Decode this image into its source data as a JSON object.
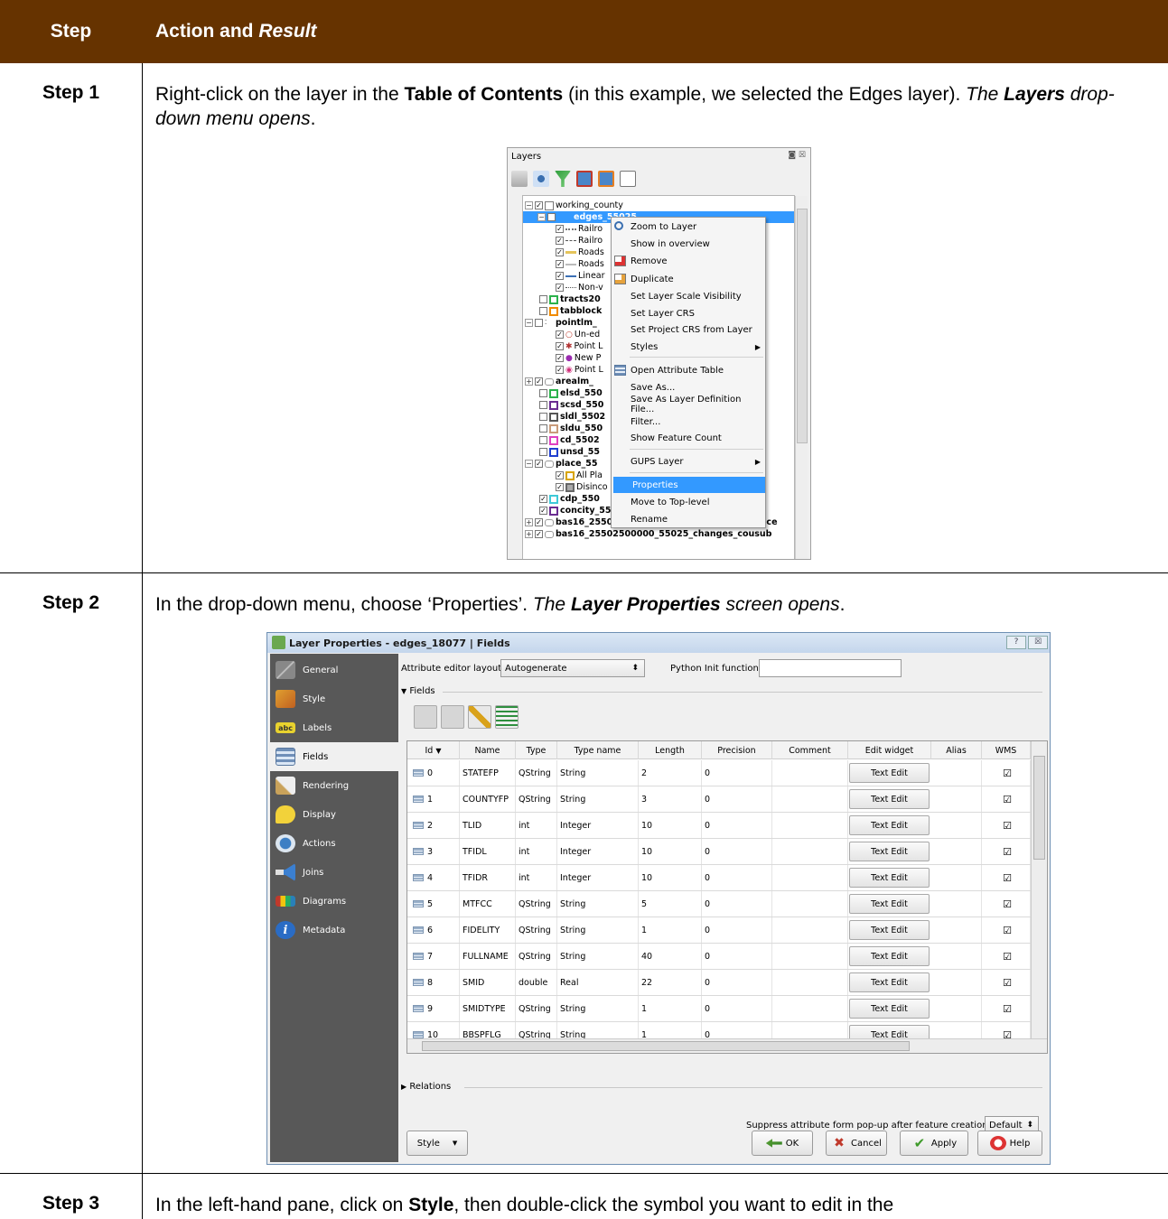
{
  "table": {
    "header_step": "Step",
    "header_action": "Action and",
    "header_result": "Result"
  },
  "step1": {
    "label": "Step 1",
    "text_a": "Right-click on the layer in the ",
    "text_b": "Table of Contents",
    "text_c": " (in this example, we selected the Edges layer). ",
    "text_d": "The ",
    "text_e": "Layers",
    "text_f": " drop-down menu opens",
    "text_g": "."
  },
  "step2": {
    "label": "Step 2",
    "text_a": "In the drop-down menu, choose ‘Properties’. ",
    "text_b": "The ",
    "text_c": "Layer Properties",
    "text_d": " screen opens",
    "text_e": "."
  },
  "step3": {
    "label": "Step 3",
    "text_a": "In the left-hand pane, click on ",
    "text_b": "Style",
    "text_c": ", then double-click the symbol you want to edit in the"
  },
  "layers_panel": {
    "title": "Layers",
    "controls": "◙ ☒",
    "rows": [
      {
        "label": "working_county"
      },
      {
        "label": "edges_55025"
      },
      {
        "label": "Railro"
      },
      {
        "label": "Railro"
      },
      {
        "label": "Roads"
      },
      {
        "label": "Roads"
      },
      {
        "label": "Linear"
      },
      {
        "label": "Non-v"
      },
      {
        "label": "tracts20"
      },
      {
        "label": "tabblock"
      },
      {
        "label": "pointlm_"
      },
      {
        "label": "Un-ed"
      },
      {
        "label": "Point L"
      },
      {
        "label": "New P"
      },
      {
        "label": "Point L"
      },
      {
        "label": "arealm_"
      },
      {
        "label": "elsd_550"
      },
      {
        "label": "scsd_550"
      },
      {
        "label": "sldl_5502"
      },
      {
        "label": "sldu_550"
      },
      {
        "label": "cd_5502"
      },
      {
        "label": "unsd_55"
      },
      {
        "label": "place_55"
      },
      {
        "label": "All Pla"
      },
      {
        "label": "Disinco"
      },
      {
        "label": "cdp_550"
      },
      {
        "label": "concity_55025"
      },
      {
        "label": "bas16_25502500000_55025_changes_incplace"
      },
      {
        "label": "bas16_25502500000_55025_changes_cousub"
      }
    ]
  },
  "context_menu": {
    "items": [
      "Zoom to Layer",
      "Show in overview",
      "Remove",
      "Duplicate",
      "Set Layer Scale Visibility",
      "Set Layer CRS",
      "Set Project CRS from Layer",
      "Styles",
      "Open Attribute Table",
      "Save As...",
      "Save As Layer Definition File...",
      "Filter...",
      "Show Feature Count",
      "GUPS Layer",
      "Properties",
      "Move to Top-level",
      "Rename"
    ]
  },
  "dialog": {
    "title": "Layer Properties - edges_18077 | Fields",
    "help_btn": "?",
    "close_btn": "☒",
    "sidebar": [
      "General",
      "Style",
      "Labels",
      "Fields",
      "Rendering",
      "Display",
      "Actions",
      "Joins",
      "Diagrams",
      "Metadata"
    ],
    "labels_badge": "abc",
    "attr_layout_label": "Attribute editor layout:",
    "attr_layout_value": "Autogenerate",
    "python_init_label": "Python Init function",
    "python_init_value": "",
    "fields_group": "Fields",
    "relations_group": "Relations",
    "columns": [
      "Id",
      "Name",
      "Type",
      "Type name",
      "Length",
      "Precision",
      "Comment",
      "Edit widget",
      "Alias",
      "WMS"
    ],
    "rows": [
      {
        "id": "0",
        "name": "STATEFP",
        "type": "QString",
        "type_name": "String",
        "length": "2",
        "precision": "0",
        "widget": "Text Edit"
      },
      {
        "id": "1",
        "name": "COUNTYFP",
        "type": "QString",
        "type_name": "String",
        "length": "3",
        "precision": "0",
        "widget": "Text Edit"
      },
      {
        "id": "2",
        "name": "TLID",
        "type": "int",
        "type_name": "Integer",
        "length": "10",
        "precision": "0",
        "widget": "Text Edit"
      },
      {
        "id": "3",
        "name": "TFIDL",
        "type": "int",
        "type_name": "Integer",
        "length": "10",
        "precision": "0",
        "widget": "Text Edit"
      },
      {
        "id": "4",
        "name": "TFIDR",
        "type": "int",
        "type_name": "Integer",
        "length": "10",
        "precision": "0",
        "widget": "Text Edit"
      },
      {
        "id": "5",
        "name": "MTFCC",
        "type": "QString",
        "type_name": "String",
        "length": "5",
        "precision": "0",
        "widget": "Text Edit"
      },
      {
        "id": "6",
        "name": "FIDELITY",
        "type": "QString",
        "type_name": "String",
        "length": "1",
        "precision": "0",
        "widget": "Text Edit"
      },
      {
        "id": "7",
        "name": "FULLNAME",
        "type": "QString",
        "type_name": "String",
        "length": "40",
        "precision": "0",
        "widget": "Text Edit"
      },
      {
        "id": "8",
        "name": "SMID",
        "type": "double",
        "type_name": "Real",
        "length": "22",
        "precision": "0",
        "widget": "Text Edit"
      },
      {
        "id": "9",
        "name": "SMIDTYPE",
        "type": "QString",
        "type_name": "String",
        "length": "1",
        "precision": "0",
        "widget": "Text Edit"
      },
      {
        "id": "10",
        "name": "BBSPFLG",
        "type": "QString",
        "type_name": "String",
        "length": "1",
        "precision": "0",
        "widget": "Text Edit"
      }
    ],
    "suppress_label": "Suppress attribute form pop-up after feature creation",
    "suppress_value": "Default",
    "style_btn": "Style",
    "ok_btn": "OK",
    "cancel_btn": "Cancel",
    "apply_btn": "Apply",
    "help_text_btn": "Help"
  },
  "colors": {
    "header_bg": "#663300",
    "dialog_sidebar": "#585858",
    "selection": "#3399ff"
  }
}
